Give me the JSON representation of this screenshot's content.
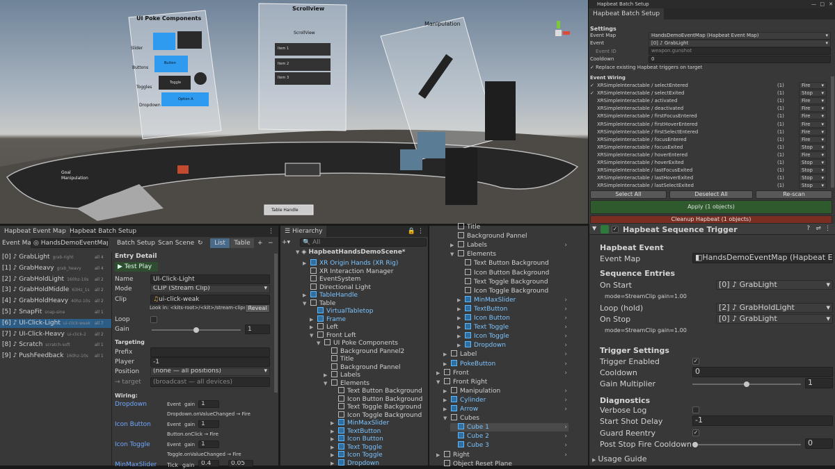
{
  "scene": {
    "panels": {
      "poke": "UI Poke Components",
      "scroll": "Scrollview",
      "scroll_sub": "ScrollView",
      "manip": "Manipulation",
      "slider": "Slider",
      "buttons": "Buttons",
      "toggles": "Toggles",
      "dropdown": "Dropdown",
      "button": "Button",
      "toggle": "Toggle",
      "option": "Option A",
      "items": [
        "Item 1",
        "Item 2",
        "Item 3"
      ],
      "table_handle": "Table Handle",
      "goal": "Goal\nManipulation"
    }
  },
  "batch": {
    "window_title": "Hapbeat Batch Setup",
    "tab": "Hapbeat Batch Setup",
    "settings_h": "Settings",
    "event_map_l": "Event Map",
    "event_map_v": "HandsDemoEventMap (Hapbeat Event Map)",
    "event_l": "Event",
    "event_v": "[0] ♪ GrabLight",
    "event_id_l": "Event ID",
    "event_id_v": "weapon.gunshot",
    "cooldown_l": "Cooldown",
    "cooldown_v": "0",
    "replace": "Replace existing Hapbeat triggers on target",
    "wiring_h": "Event Wiring",
    "rows": [
      [
        "✓",
        "XRSimpleInteractable / selectEntered",
        "(1)",
        "Fire"
      ],
      [
        "✓",
        "XRSimpleInteractable / selectExited",
        "(1)",
        "Stop"
      ],
      [
        "",
        "XRSimpleInteractable / activated",
        "(1)",
        "Fire"
      ],
      [
        "",
        "XRSimpleInteractable / deactivated",
        "(1)",
        "Fire"
      ],
      [
        "",
        "XRSimpleInteractable / firstFocusEntered",
        "(1)",
        "Fire"
      ],
      [
        "",
        "XRSimpleInteractable / firstHoverEntered",
        "(1)",
        "Fire"
      ],
      [
        "",
        "XRSimpleInteractable / firstSelectEntered",
        "(1)",
        "Fire"
      ],
      [
        "",
        "XRSimpleInteractable / focusEntered",
        "(1)",
        "Fire"
      ],
      [
        "",
        "XRSimpleInteractable / focusExited",
        "(1)",
        "Stop"
      ],
      [
        "",
        "XRSimpleInteractable / hoverEntered",
        "(1)",
        "Fire"
      ],
      [
        "",
        "XRSimpleInteractable / hoverExited",
        "(1)",
        "Stop"
      ],
      [
        "",
        "XRSimpleInteractable / lastFocusExited",
        "(1)",
        "Stop"
      ],
      [
        "",
        "XRSimpleInteractable / lastHoverExited",
        "(1)",
        "Stop"
      ],
      [
        "",
        "XRSimpleInteractable / lastSelectExited",
        "(1)",
        "Stop"
      ]
    ],
    "select_all": "Select All",
    "deselect_all": "Deselect All",
    "rescan": "Re-scan",
    "apply": "Apply (1 objects)",
    "cleanup": "Cleanup Hapbeat (1 objects)"
  },
  "eventmap": {
    "tab1": "Hapbeat Event Map",
    "tab2": "Hapbeat Batch Setup",
    "em_label": "Event Ma",
    "em_value": "HandsDemoEventMap",
    "batch_setup": "Batch Setup",
    "scan_scene": "Scan Scene",
    "list": "List",
    "table": "Table",
    "items": [
      [
        "[0] ♪ GrabLight",
        "grab-right",
        "all 4"
      ],
      [
        "[1] ♪ GrabHeavy",
        "grab_heavy",
        "all 4"
      ],
      [
        "[2] ♪ GrabHoldLight",
        "160hz-10s",
        "all 2"
      ],
      [
        "[3] ♪ GrabHoldMiddle",
        "63Hz_1s",
        "all 2"
      ],
      [
        "[4] ♪ GrabHoldHeavy",
        "40hz-10s",
        "all 2"
      ],
      [
        "[5] ♪ SnapFit",
        "snap-sine",
        "all 1"
      ],
      [
        "[6] ♪ UI-Click-Light",
        "ui-click-weak",
        "all 7"
      ],
      [
        "[7] ♪ UI-Click-Heavy",
        "ui-click-2",
        "all 2"
      ],
      [
        "[8] ♪ Scratch",
        "scratch-soft",
        "all 1"
      ],
      [
        "[9] ♪ PushFeedback",
        "160hz-10s",
        "all 1"
      ]
    ],
    "entry_detail": "Entry Detail",
    "test_play": "▶ Test Play",
    "name_l": "Name",
    "name_v": "UI-Click-Light",
    "mode_l": "Mode",
    "mode_v": "CLIP (Stream Clip)",
    "clip_l": "Clip",
    "clip_v": "ui-click-weak",
    "look_in": "Look in: <kits-root>/<kit>/stream-clips/",
    "reveal": "Reveal",
    "loop_l": "Loop",
    "gain_l": "Gain",
    "gain_v": "1",
    "targeting": "Targeting",
    "prefix_l": "Prefix",
    "player_l": "Player",
    "player_v": "-1",
    "position_l": "Position",
    "position_v": "(none — all positions)",
    "target_l": "→ target",
    "target_v": "(broadcast — all devices)",
    "wiring": "Wiring:",
    "wires": [
      [
        "Dropdown",
        "Event",
        "gain",
        "1",
        "Dropdown.onValueChanged → Fire"
      ],
      [
        "Icon Button",
        "Event",
        "gain",
        "1",
        "Button.onClick → Fire"
      ],
      [
        "Icon Toggle",
        "Event",
        "gain",
        "1",
        "Toggle.onValueChanged → Fire"
      ]
    ],
    "minmax": "MinMaxSlider",
    "tick": "Tick",
    "gain2": "gain",
    "v1": "0.4",
    "v2": "0.05"
  },
  "hier": {
    "tab": "Hierarchy",
    "search": "All",
    "scene_name": "HapbeatHandsDemoScene*",
    "items": [
      [
        "XR Origin Hands (XR Rig)",
        1,
        true,
        "▶"
      ],
      [
        "XR Interaction Manager",
        1,
        false,
        ""
      ],
      [
        "EventSystem",
        1,
        false,
        ""
      ],
      [
        "Directional Light",
        1,
        false,
        ""
      ],
      [
        "TableHandle",
        1,
        true,
        "▶"
      ],
      [
        "Table",
        1,
        false,
        "▼"
      ],
      [
        "VirtualTabletop",
        2,
        true,
        ""
      ],
      [
        "Frame",
        2,
        true,
        "▶"
      ],
      [
        "Left",
        2,
        false,
        "▶"
      ],
      [
        "Front Left",
        2,
        false,
        "▼"
      ],
      [
        "UI Poke Components",
        3,
        false,
        "▼"
      ],
      [
        "Background Pannel2",
        4,
        false,
        ""
      ],
      [
        "Title",
        4,
        false,
        ""
      ],
      [
        "Background Pannel",
        4,
        false,
        ""
      ],
      [
        "Labels",
        4,
        false,
        "▶"
      ],
      [
        "Elements",
        4,
        false,
        "▼"
      ],
      [
        "Text Button Background",
        5,
        false,
        ""
      ],
      [
        "Icon Button Background",
        5,
        false,
        ""
      ],
      [
        "Text Toggle Background",
        5,
        false,
        ""
      ],
      [
        "Icon Toggle Background",
        5,
        false,
        ""
      ],
      [
        "MinMaxSlider",
        5,
        true,
        "▶"
      ],
      [
        "TextButton",
        5,
        true,
        "▶"
      ],
      [
        "Icon Button",
        5,
        true,
        "▶"
      ],
      [
        "Text Toggle",
        5,
        true,
        "▶"
      ],
      [
        "Icon Toggle",
        5,
        true,
        "▶"
      ],
      [
        "Dropdown",
        5,
        true,
        "▶"
      ]
    ]
  },
  "hier2": {
    "items": [
      [
        "Title",
        3,
        false,
        ""
      ],
      [
        "Background Pannel",
        3,
        false,
        ""
      ],
      [
        "Labels",
        3,
        false,
        "▶"
      ],
      [
        "Elements",
        3,
        false,
        "▼"
      ],
      [
        "Text Button Background",
        4,
        false,
        ""
      ],
      [
        "Icon Button Background",
        4,
        false,
        ""
      ],
      [
        "Text Toggle Background",
        4,
        false,
        ""
      ],
      [
        "Icon Toggle Background",
        4,
        false,
        ""
      ],
      [
        "MinMaxSlider",
        4,
        true,
        "▶"
      ],
      [
        "TextButton",
        4,
        true,
        "▶"
      ],
      [
        "Icon Button",
        4,
        true,
        "▶"
      ],
      [
        "Text Toggle",
        4,
        true,
        "▶"
      ],
      [
        "Icon Toggle",
        4,
        true,
        "▶"
      ],
      [
        "Dropdown",
        4,
        true,
        "▶"
      ],
      [
        "Label",
        2,
        false,
        "▶"
      ],
      [
        "PokeButton",
        2,
        true,
        "▶"
      ],
      [
        "Front",
        1,
        false,
        "▶"
      ],
      [
        "Front Right",
        1,
        false,
        "▼"
      ],
      [
        "Manipulation",
        2,
        false,
        "▶"
      ],
      [
        "Cylinder",
        2,
        true,
        "▶"
      ],
      [
        "Arrow",
        2,
        true,
        "▶"
      ],
      [
        "Cubes",
        2,
        false,
        "▼"
      ],
      [
        "Cube 1",
        3,
        true,
        ""
      ],
      [
        "Cube 2",
        3,
        true,
        ""
      ],
      [
        "Cube 3",
        3,
        true,
        ""
      ],
      [
        "Right",
        1,
        false,
        "▶"
      ],
      [
        "Object Reset Plane",
        1,
        false,
        ""
      ]
    ]
  },
  "inspector": {
    "title": "Hapbeat Sequence Trigger",
    "hapbeat_event": "Hapbeat Event",
    "event_map_l": "Event Map",
    "event_map_v": "HandsDemoEventMap (Hapbeat Even",
    "seq": "Sequence Entries",
    "on_start": "On Start",
    "on_start_v": "[0] ♪ GrabLight",
    "mode1": "mode=StreamClip  gain=1.00",
    "loop": "Loop (hold)",
    "loop_v": "[2] ♪ GrabHoldLight",
    "on_stop": "On Stop",
    "on_stop_v": "[0] ♪ GrabLight",
    "mode2": "mode=StreamClip  gain=1.00",
    "trig": "Trigger Settings",
    "trig_enabled": "Trigger Enabled",
    "cooldown": "Cooldown",
    "cooldown_v": "0",
    "gain_mult": "Gain Multiplier",
    "gain_mult_v": "1",
    "diag": "Diagnostics",
    "verbose": "Verbose Log",
    "start_delay": "Start Shot Delay",
    "start_delay_v": "-1",
    "guard": "Guard Reentry",
    "post_stop": "Post Stop Fire Cooldown",
    "post_stop_v": "0",
    "usage": "Usage Guide"
  }
}
